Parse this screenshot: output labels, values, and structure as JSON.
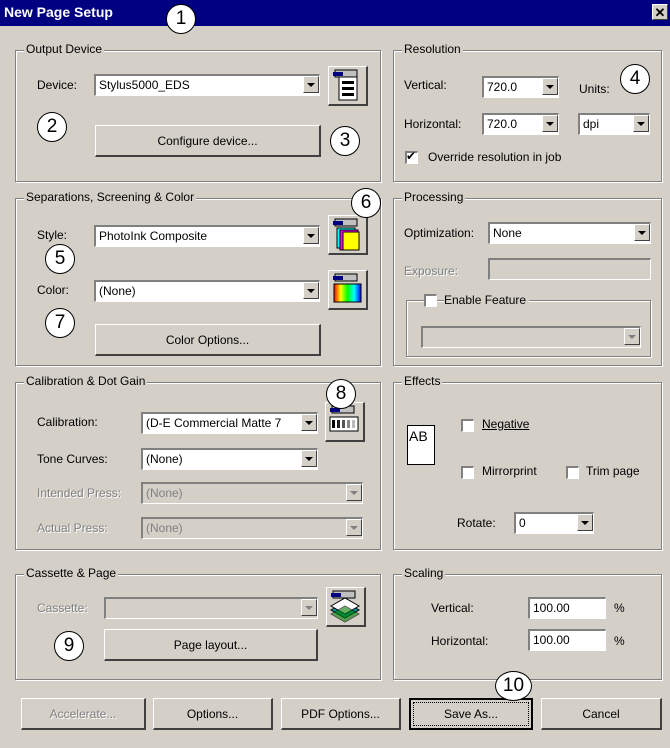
{
  "window": {
    "title": "New Page Setup",
    "close_glyph": "✕"
  },
  "callouts": [
    "1",
    "2",
    "3",
    "4",
    "5",
    "6",
    "7",
    "8",
    "9",
    "10"
  ],
  "output_device": {
    "group_label": "Output Device",
    "device_label": "Device:",
    "device_value": "Stylus5000_EDS",
    "configure_button": "Configure device..."
  },
  "resolution": {
    "group_label": "Resolution",
    "vertical_label": "Vertical:",
    "vertical_value": "720.0",
    "horizontal_label": "Horizontal:",
    "horizontal_value": "720.0",
    "units_label": "Units:",
    "units_value": "dpi",
    "override_label": "Override resolution in job",
    "override_checked": true
  },
  "separations": {
    "group_label": "Separations, Screening & Color",
    "style_label": "Style:",
    "style_value": "PhotoInk Composite",
    "color_label": "Color:",
    "color_value": "(None)",
    "color_options_button": "Color Options..."
  },
  "processing": {
    "group_label": "Processing",
    "optimization_label": "Optimization:",
    "optimization_value": "None",
    "exposure_label": "Exposure:",
    "exposure_value": "",
    "enable_feature_label": "Enable Feature",
    "enable_feature_checked": false,
    "feature_value": ""
  },
  "calibration": {
    "group_label": "Calibration & Dot Gain",
    "calibration_label": "Calibration:",
    "calibration_value": "(D-E Commercial Matte 7",
    "tone_curves_label": "Tone Curves:",
    "tone_curves_value": "(None)",
    "intended_press_label": "Intended Press:",
    "intended_press_value": "(None)",
    "actual_press_label": "Actual Press:",
    "actual_press_value": "(None)"
  },
  "effects": {
    "group_label": "Effects",
    "preview_text": "AB",
    "negative_label": "Negative",
    "mirrorprint_label": "Mirrorprint",
    "trim_page_label": "Trim page",
    "rotate_label": "Rotate:",
    "rotate_value": "0"
  },
  "cassette": {
    "group_label": "Cassette & Page",
    "cassette_label": "Cassette:",
    "cassette_value": "",
    "page_layout_button": "Page layout..."
  },
  "scaling": {
    "group_label": "Scaling",
    "vertical_label": "Vertical:",
    "vertical_value": "100.00",
    "horizontal_label": "Horizontal:",
    "horizontal_value": "100.00",
    "unit": "%"
  },
  "footer": {
    "accelerate": "Accelerate...",
    "options": "Options...",
    "pdf_options": "PDF Options...",
    "save_as": "Save As...",
    "cancel": "Cancel"
  }
}
